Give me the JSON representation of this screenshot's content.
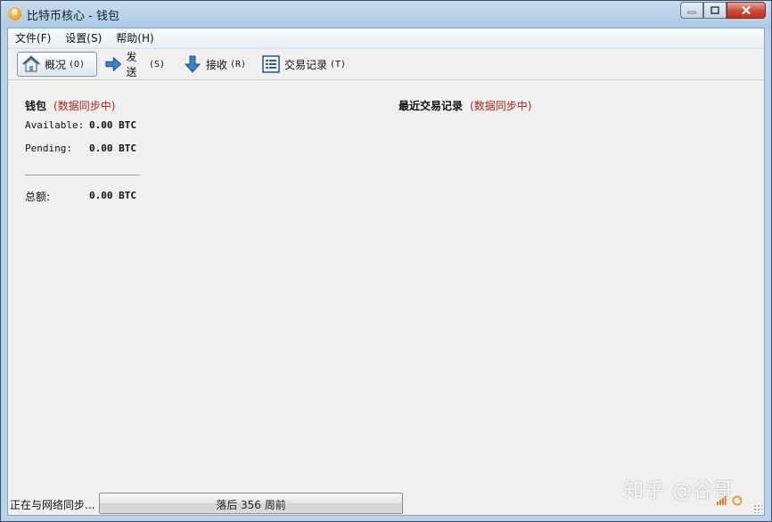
{
  "window": {
    "title": "比特币核心 - 钱包",
    "app_icon_glyph": "B"
  },
  "menu": {
    "items": [
      "文件(F)",
      "设置(S)",
      "帮助(H)"
    ]
  },
  "toolbar": {
    "overview": {
      "icon": "home-icon",
      "label": "概况",
      "shortcut": "(O)"
    },
    "send": {
      "icon": "arrow-right-icon",
      "label": "发送",
      "shortcut": "(S)"
    },
    "receive": {
      "icon": "arrow-down-icon",
      "label": "接收",
      "shortcut": "(R)"
    },
    "transactions": {
      "icon": "list-icon",
      "label": "交易记录",
      "shortcut": "(T)"
    }
  },
  "wallet": {
    "title": "钱包",
    "sync_status": "(数据同步中)",
    "available_label": "Available:",
    "available_value": "0.00 BTC",
    "pending_label": "Pending:",
    "pending_value": "0.00 BTC",
    "total_label": "总额:",
    "total_value": "0.00 BTC"
  },
  "recent": {
    "title": "最近交易记录",
    "sync_status": "(数据同步中)"
  },
  "status": {
    "text": "正在与网络同步...",
    "progress_text": "落后 356 周前",
    "progress_fraction": 0
  },
  "watermark": {
    "text": "知乎 @谷哥"
  },
  "colors": {
    "sync_red": "#b0241a",
    "accent_blue": "#2e6fb8"
  }
}
